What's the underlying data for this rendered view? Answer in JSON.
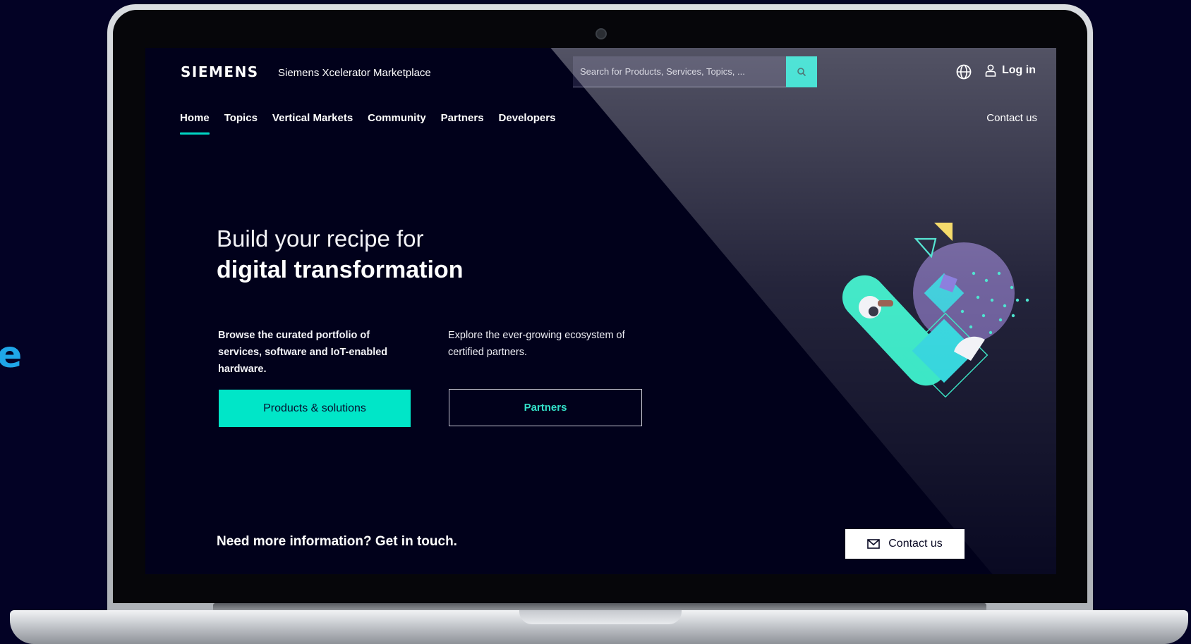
{
  "edge_letter": "e",
  "header": {
    "logo": "SIEMENS",
    "marketplace_name": "Siemens Xcelerator Marketplace",
    "search_placeholder": "Search for Products, Services, Topics, ...",
    "login_label": "Log in"
  },
  "nav": {
    "items": [
      {
        "label": "Home",
        "active": true
      },
      {
        "label": "Topics",
        "active": false
      },
      {
        "label": "Vertical Markets",
        "active": false
      },
      {
        "label": "Community",
        "active": false
      },
      {
        "label": "Partners",
        "active": false
      },
      {
        "label": "Developers",
        "active": false
      }
    ],
    "contact_label": "Contact us"
  },
  "hero": {
    "line1": "Build your recipe for",
    "line2": "digital transformation",
    "left_copy": "Browse the curated portfolio of services, software and IoT-enabled hardware.",
    "right_copy": "Explore the ever-growing ecosystem of certified partners.",
    "primary_button": "Products & solutions",
    "secondary_button": "Partners"
  },
  "footer_cta": {
    "text": "Need more information? Get in touch.",
    "button": "Contact us"
  },
  "colors": {
    "accent": "#00d7c4",
    "background": "#01011b",
    "illustration_purple": "#6b4f9e",
    "illustration_yellow": "#f3d34a"
  },
  "icons": [
    "search-icon",
    "globe-icon",
    "user-icon",
    "mail-icon"
  ]
}
